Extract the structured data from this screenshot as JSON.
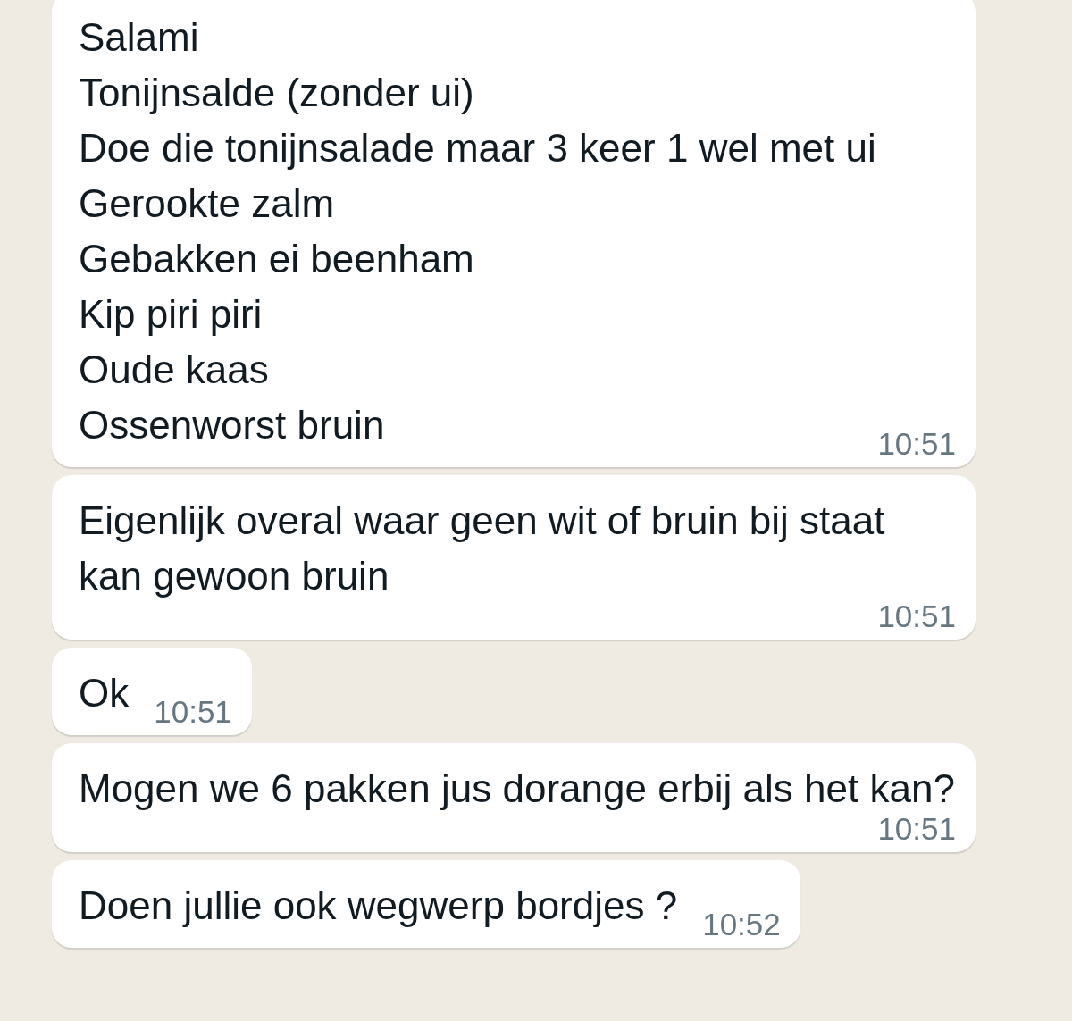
{
  "messages": [
    {
      "kind": "list",
      "lines": [
        "Salami",
        "Tonijnsalde (zonder ui)",
        "Doe die tonijnsalade maar 3 keer 1 wel met ui",
        "Gerookte zalm",
        "Gebakken ei beenham",
        "Kip piri piri",
        "Oude kaas",
        "Ossenworst bruin"
      ],
      "time": "10:51"
    },
    {
      "kind": "text",
      "text": "Eigenlijk overal waar geen wit of bruin bij staat kan gewoon bruin",
      "time": "10:51"
    },
    {
      "kind": "text",
      "text": "Ok",
      "time": "10:51"
    },
    {
      "kind": "text",
      "text": "Mogen we 6 pakken jus dorange erbij als het kan?",
      "time": "10:51"
    },
    {
      "kind": "text",
      "text": "Doen jullie ook wegwerp bordjes ?",
      "time": "10:52"
    }
  ]
}
